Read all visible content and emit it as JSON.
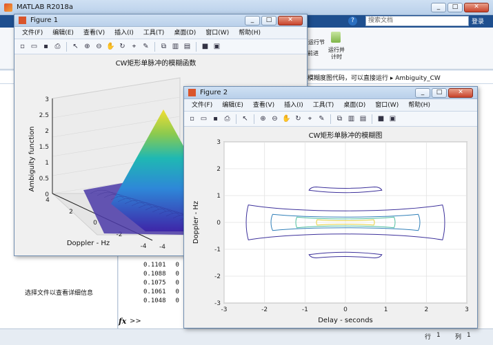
{
  "matlab": {
    "title": "MATLAB R2018a",
    "search_placeholder": "搜索文档",
    "login_label": "登录",
    "run_section": "运行节",
    "advance_label": "前进",
    "run_and_time": "运行并",
    "run_and_time_2": "计时",
    "path_text": "模糊度图代码，可以直接运行 ▸ Ambiguity_CW",
    "file_detail_hint": "选择文件以查看详细信息",
    "command_values": [
      "0.1101",
      "0.1088",
      "0.1075",
      "0.1061",
      "0.1048"
    ],
    "command_col2": [
      "0",
      "0",
      "0",
      "0",
      "0"
    ],
    "fx_label": "fx",
    "prompt": ">>",
    "status_row_label": "行",
    "status_row_value": "1",
    "status_col_label": "列",
    "status_col_value": "1"
  },
  "figure1": {
    "title": "Figure 1",
    "menu": [
      "文件(F)",
      "编辑(E)",
      "查看(V)",
      "插入(I)",
      "工具(T)",
      "桌面(D)",
      "窗口(W)",
      "帮助(H)"
    ],
    "plot_title": "CW矩形单脉冲的模糊函数",
    "zlabel": "Ambiguity function",
    "xlabel": "Doppler - Hz",
    "z_ticks": [
      "3",
      "2.5",
      "2",
      "1.5",
      "1",
      "0.5",
      "0"
    ],
    "doppler_ticks": [
      "4",
      "2",
      "0",
      "-2",
      "-4"
    ],
    "delay_ticks": [
      "-4"
    ]
  },
  "figure2": {
    "title": "Figure 2",
    "menu": [
      "文件(F)",
      "编辑(E)",
      "查看(V)",
      "插入(I)",
      "工具(T)",
      "桌面(D)",
      "窗口(W)",
      "帮助(H)"
    ]
  },
  "chart_data": [
    {
      "type": "surface",
      "title": "CW矩形单脉冲的模糊函数",
      "xlabel": "Doppler - Hz",
      "zlabel": "Ambiguity function",
      "zlim": [
        0,
        3
      ],
      "doppler_range": [
        -4,
        4
      ],
      "peak": 2.2,
      "colormap": "parula"
    },
    {
      "type": "contour",
      "title": "CW矩形单脉冲的模糊图",
      "xlabel": "Delay - seconds",
      "ylabel": "Doppler - Hz",
      "xlim": [
        -3,
        3
      ],
      "ylim": [
        -3,
        3
      ],
      "x_ticks": [
        -3,
        -2,
        -1,
        0,
        1,
        2,
        3
      ],
      "y_ticks": [
        -3,
        -2,
        -1,
        0,
        1,
        2,
        3
      ],
      "grid": true,
      "levels": [
        {
          "color": "#3b2f9a",
          "delay_halfwidth": 2.4,
          "doppler_halfwidth": 0.65
        },
        {
          "color": "#2f7fb8",
          "delay_halfwidth": 1.8,
          "doppler_halfwidth": 0.3
        },
        {
          "color": "#4fbfa0",
          "delay_halfwidth": 1.2,
          "doppler_halfwidth": 0.2
        },
        {
          "color": "#e6cf3c",
          "delay_halfwidth": 0.7,
          "doppler_halfwidth": 0.1
        }
      ],
      "sidelobes": [
        {
          "color": "#3b2f9a",
          "doppler": 1.2,
          "delay_halfwidth": 0.9
        },
        {
          "color": "#3b2f9a",
          "doppler": -1.2,
          "delay_halfwidth": 0.9
        }
      ]
    }
  ]
}
